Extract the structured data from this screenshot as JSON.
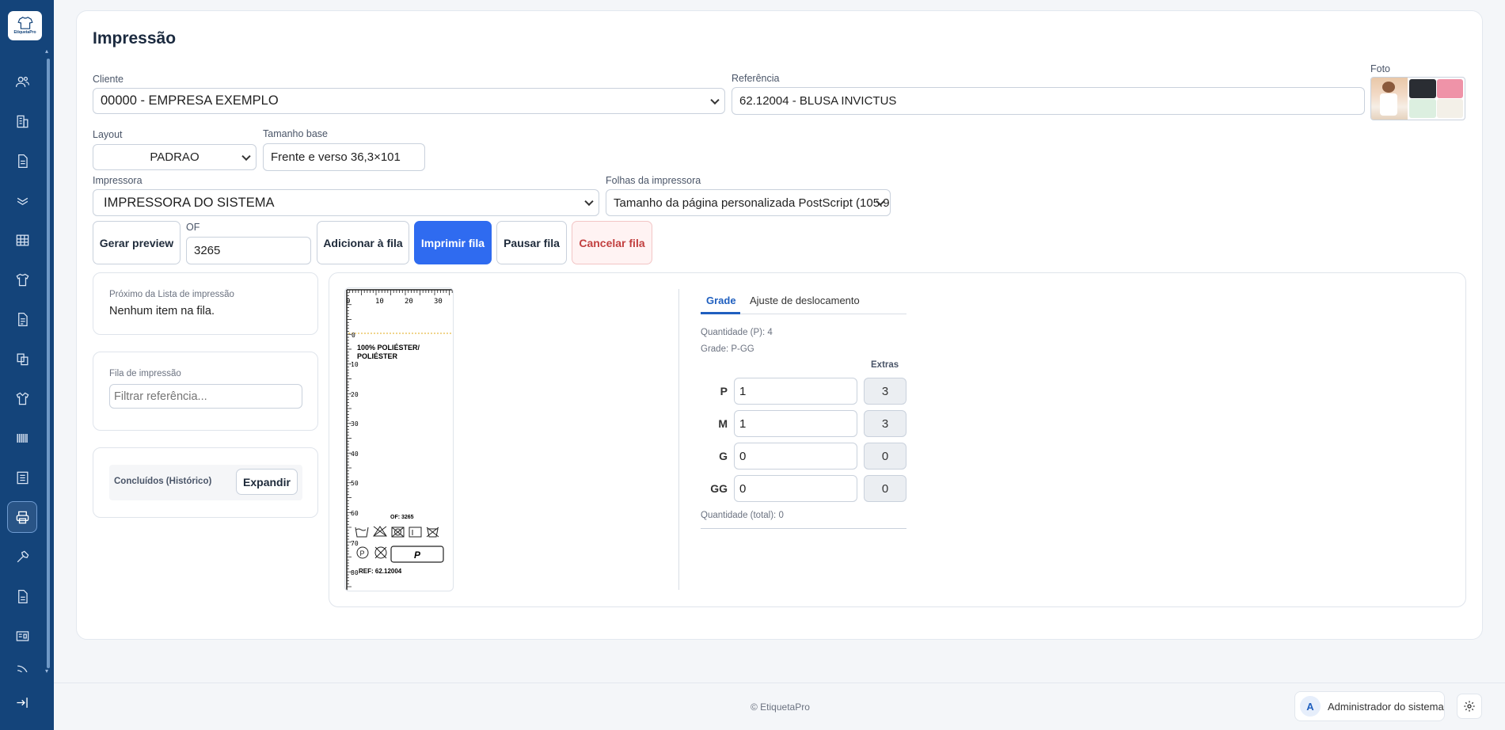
{
  "app": {
    "logo_text": "EtiquetaPro",
    "footer": "© EtiquetaPro"
  },
  "page": {
    "title": "Impressão"
  },
  "cliente": {
    "label": "Cliente",
    "value": "00000 -   EMPRESA EXEMPLO"
  },
  "referencia": {
    "label": "Referência",
    "value": "62.12004     - BLUSA INVICTUS"
  },
  "foto": {
    "label": "Foto",
    "swatches": [
      "#2a2d33",
      "#ef93a8",
      "#dcefe0",
      "#f3f0e8"
    ]
  },
  "layout": {
    "label": "Layout",
    "value": "PADRAO"
  },
  "tamanho_base": {
    "label": "Tamanho base",
    "value": "Frente e verso 36,3×101"
  },
  "impressora": {
    "label": "Impressora",
    "value": "IMPRESSORA DO SISTEMA"
  },
  "folhas": {
    "label": "Folhas da impressora",
    "value": "Tamanho da página personalizada PostScript (105.9"
  },
  "actions": {
    "gerar_preview": "Gerar preview",
    "of_label": "OF",
    "of_value": "3265",
    "adicionar": "Adicionar à fila",
    "imprimir": "Imprimir fila",
    "pausar": "Pausar fila",
    "cancelar": "Cancelar fila"
  },
  "proximo": {
    "label": "Próximo da Lista de impressão",
    "value": "Nenhum item na fila."
  },
  "fila": {
    "label": "Fila de impressão",
    "placeholder": "Filtrar referência..."
  },
  "historico": {
    "label": "Concluídos (Histórico)",
    "button": "Expandir"
  },
  "preview": {
    "ruler_top": [
      "0",
      "10",
      "20",
      "30"
    ],
    "ruler_left": [
      "0",
      "10",
      "20",
      "30",
      "40",
      "50",
      "60",
      "70",
      "80"
    ],
    "composition": [
      "100% POLIÉSTER/",
      "POLIÉSTER"
    ],
    "of_text": "OF: 3265",
    "size": "P",
    "ref_text": "REF: 62.12004"
  },
  "tabs": {
    "grade": "Grade",
    "ajuste": "Ajuste de deslocamento"
  },
  "grade": {
    "quantidade_p": "Quantidade (P): 4",
    "grade_text": "Grade: P-GG",
    "extras_label": "Extras",
    "rows": [
      {
        "size": "P",
        "qty": "1",
        "extra": "3"
      },
      {
        "size": "M",
        "qty": "1",
        "extra": "3"
      },
      {
        "size": "G",
        "qty": "0",
        "extra": "0"
      },
      {
        "size": "GG",
        "qty": "0",
        "extra": "0"
      }
    ],
    "total": "Quantidade (total): 0"
  },
  "user": {
    "initial": "A",
    "name": "Administrador do sistema"
  }
}
